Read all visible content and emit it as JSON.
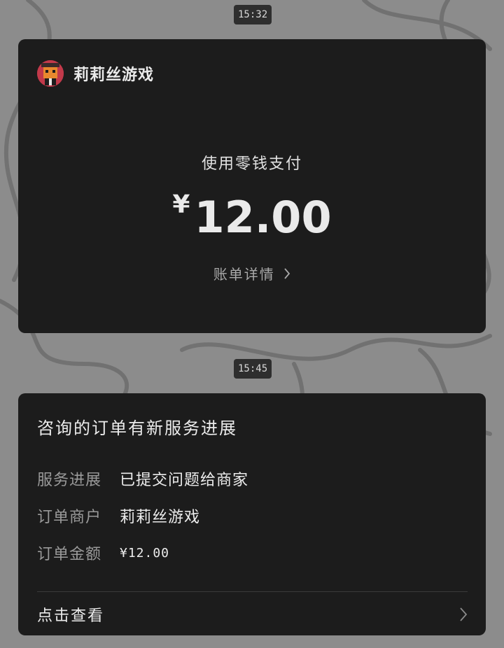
{
  "messages": [
    {
      "time": "15:32",
      "merchant_name": "莉莉丝游戏",
      "pay_method": "使用零钱支付",
      "currency_symbol": "¥",
      "amount": "12.00",
      "bill_link_label": "账单详情"
    },
    {
      "time": "15:45",
      "title": "咨询的订单有新服务进展",
      "rows": [
        {
          "label": "服务进展",
          "value": "已提交问题给商家"
        },
        {
          "label": "订单商户",
          "value": "莉莉丝游戏"
        },
        {
          "label": "订单金额",
          "value": "¥12.00"
        }
      ],
      "view_label": "点击查看"
    }
  ],
  "icons": {
    "avatar": "merchant-logo-icon",
    "bill_chevron": "chevron-right-icon",
    "view_chevron": "chevron-right-icon"
  },
  "colors": {
    "card_bg": "#1c1c1c",
    "page_bg": "#8c8c8c",
    "secondary_text": "#9a9a9a"
  }
}
